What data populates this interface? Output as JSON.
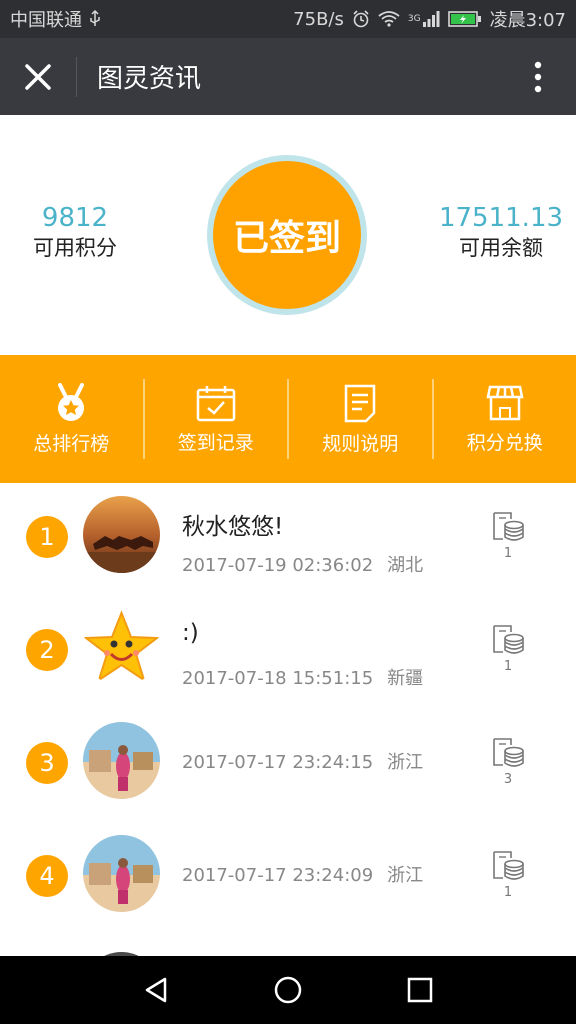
{
  "status_bar": {
    "carrier": "中国联通",
    "net_speed": "75B/s",
    "time": "凌晨3:07",
    "network_type": "3G"
  },
  "titlebar": {
    "title": "图灵资讯",
    "close_icon": "close-icon",
    "more_icon": "more-vertical-icon"
  },
  "summary": {
    "points_value": "9812",
    "points_label": "可用积分",
    "signin_label": "已签到",
    "balance_value": "17511.13",
    "balance_label": "可用余额"
  },
  "menu": [
    {
      "label": "总排行榜",
      "icon": "medal-icon"
    },
    {
      "label": "签到记录",
      "icon": "calendar-check-icon"
    },
    {
      "label": "规则说明",
      "icon": "document-icon"
    },
    {
      "label": "积分兑换",
      "icon": "shop-icon"
    }
  ],
  "ranking": [
    {
      "rank": "1",
      "name": "秋水悠悠!",
      "datetime": "2017-07-19 02:36:02",
      "location": "湖北",
      "coins": "1"
    },
    {
      "rank": "2",
      "name": ":)",
      "datetime": "2017-07-18 15:51:15",
      "location": "新疆",
      "coins": "1"
    },
    {
      "rank": "3",
      "name": "",
      "datetime": "2017-07-17 23:24:15",
      "location": "浙江",
      "coins": "3"
    },
    {
      "rank": "4",
      "name": "",
      "datetime": "2017-07-17 23:24:09",
      "location": "浙江",
      "coins": "1"
    }
  ],
  "colors": {
    "accent": "#ffa500",
    "teal": "#4ab3c9",
    "titlebar": "#393a3f"
  }
}
